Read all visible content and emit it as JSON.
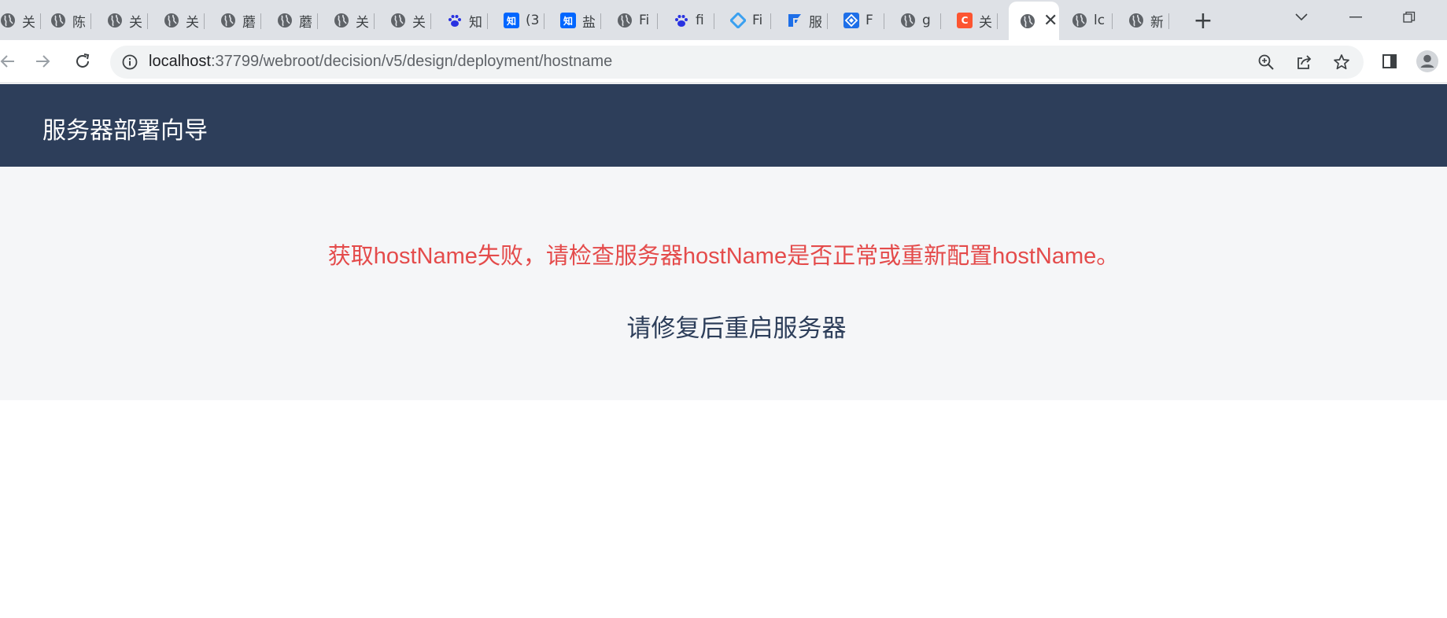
{
  "browser": {
    "tabs": [
      {
        "title": "关",
        "icon": "globe-icon"
      },
      {
        "title": "陈",
        "icon": "globe-icon"
      },
      {
        "title": "关",
        "icon": "globe-icon"
      },
      {
        "title": "关",
        "icon": "globe-icon"
      },
      {
        "title": "蘑",
        "icon": "globe-icon"
      },
      {
        "title": "蘑",
        "icon": "globe-icon"
      },
      {
        "title": "关",
        "icon": "globe-icon"
      },
      {
        "title": "关",
        "icon": "globe-icon"
      },
      {
        "title": "知",
        "icon": "baidu-paw-icon"
      },
      {
        "title": "(3",
        "icon": "zhihu-icon",
        "badge": "知"
      },
      {
        "title": "盐",
        "icon": "zhihu-icon",
        "badge": "知"
      },
      {
        "title": "Fi",
        "icon": "globe-icon"
      },
      {
        "title": "fi",
        "icon": "baidu-paw-icon"
      },
      {
        "title": "Fi",
        "icon": "diamond-logo-icon"
      },
      {
        "title": "服",
        "icon": "fanruan-logo-icon"
      },
      {
        "title": "F",
        "icon": "diamond-grid-logo-icon"
      },
      {
        "title": "g",
        "icon": "globe-icon"
      },
      {
        "title": "关",
        "icon": "csdn-icon",
        "badge": "C"
      },
      {
        "title": "",
        "icon": "globe-icon",
        "active": true
      },
      {
        "title": "lc",
        "icon": "globe-icon"
      },
      {
        "title": "新",
        "icon": "globe-icon"
      }
    ],
    "new_tab_label": "+",
    "close_glyph": "✕",
    "url": {
      "host": "localhost",
      "path": ":37799/webroot/decision/v5/design/deployment/hostname"
    }
  },
  "app": {
    "title": "服务器部署向导",
    "error_message": "获取hostName失败，请检查服务器hostName是否正常或重新配置hostName。",
    "hint_message": "请修复后重启服务器"
  },
  "colors": {
    "header_bg": "#2d3e5a",
    "error_text": "#e44b4b",
    "content_bg": "#f5f6f8"
  }
}
